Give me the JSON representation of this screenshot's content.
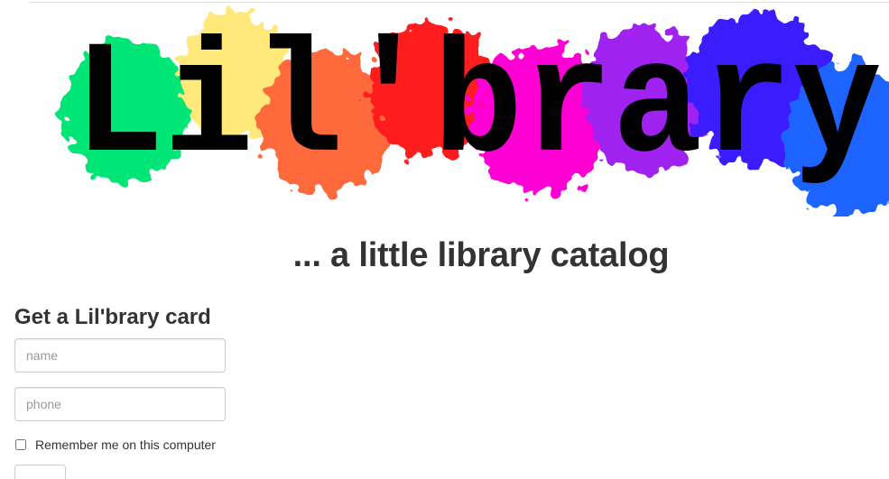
{
  "logo": {
    "text": "Lil'brary",
    "splash_colors": [
      "#00e676",
      "#ffe97a",
      "#ff6a3d",
      "#ff1a1a",
      "#ff00d4",
      "#a020f0",
      "#3a1cff",
      "#1e64ff"
    ]
  },
  "tagline": "... a little library catalog",
  "form": {
    "heading": "Get a Lil'brary card",
    "name_placeholder": "name",
    "phone_placeholder": "phone",
    "remember_label": "Remember me on this computer",
    "submit_label": ""
  }
}
